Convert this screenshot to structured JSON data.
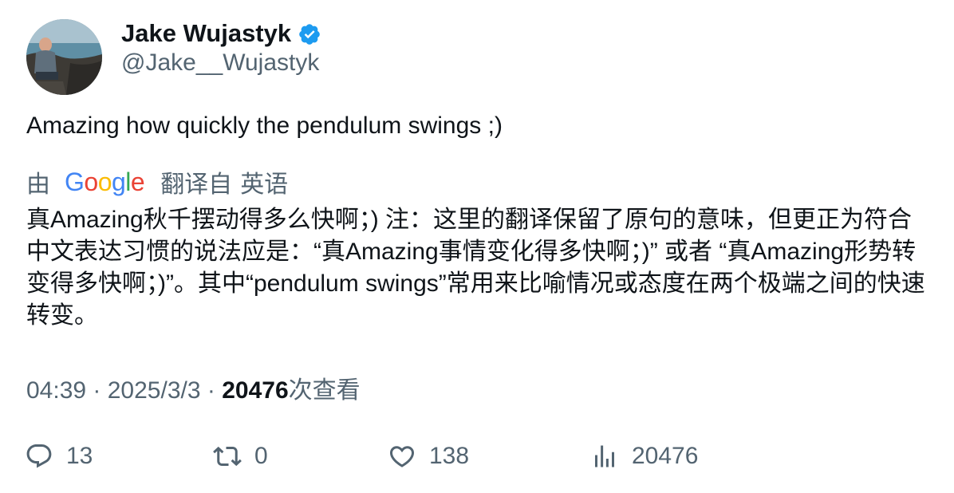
{
  "author": {
    "display_name": "Jake Wujastyk",
    "handle": "@Jake__Wujastyk",
    "verified": true,
    "verified_color": "#1d9bf0",
    "avatar_icon": "avatar-photo"
  },
  "tweet": {
    "text": "Amazing how quickly the pendulum swings ;)"
  },
  "translation": {
    "by_label": "由",
    "provider": "Google",
    "from_label": "翻译自",
    "language": "英语",
    "text": "真Amazing秋千摆动得多么快啊；) 注：这里的翻译保留了原句的意味，但更正为符合中文表达习惯的说法应是：“真Amazing事情变化得多快啊；)” 或者 “真Amazing形势转变得多快啊；)”。其中“pendulum swings”常用来比喻情况或态度在两个极端之间的快速转变。"
  },
  "meta": {
    "time": "04:39",
    "sep1": " · ",
    "date": "2025/3/3",
    "sep2": " · ",
    "views_count": "20476",
    "views_label": "次查看"
  },
  "actions": {
    "reply": {
      "icon": "reply-icon",
      "count": "13"
    },
    "retweet": {
      "icon": "retweet-icon",
      "count": "0"
    },
    "like": {
      "icon": "heart-icon",
      "count": "138"
    },
    "views": {
      "icon": "analytics-icon",
      "count": "20476"
    }
  },
  "colors": {
    "text_primary": "#0f1419",
    "text_secondary": "#536471",
    "google_blue": "#4285F4",
    "google_red": "#EA4335",
    "google_yellow": "#FBBC05",
    "google_green": "#34A853"
  }
}
